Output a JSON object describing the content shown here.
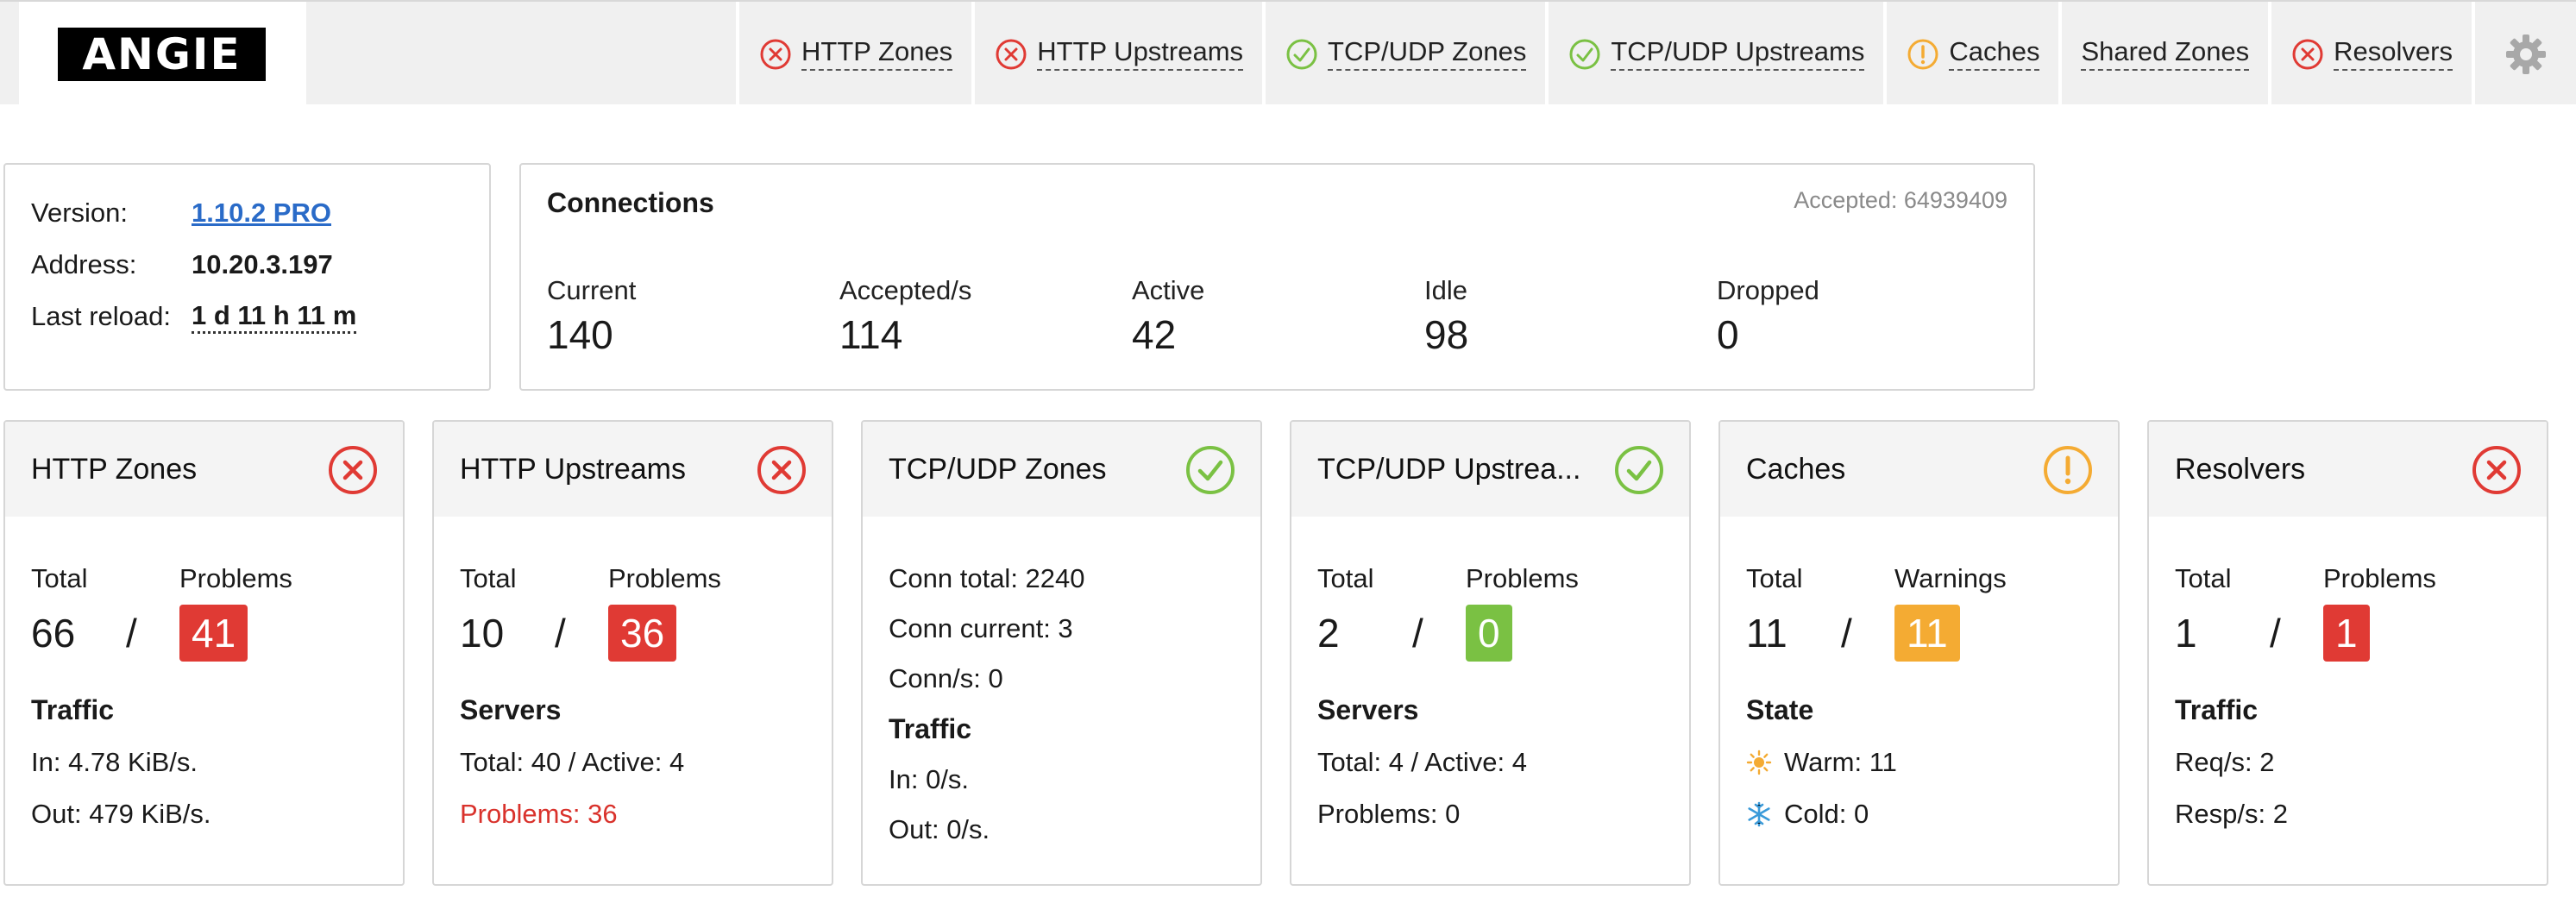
{
  "brand": {
    "logo_text": "ANGIE"
  },
  "nav": {
    "tabs": [
      {
        "label": "HTTP Zones",
        "icon": "error-icon"
      },
      {
        "label": "HTTP Upstreams",
        "icon": "error-icon"
      },
      {
        "label": "TCP/UDP Zones",
        "icon": "ok-icon"
      },
      {
        "label": "TCP/UDP Upstreams",
        "icon": "ok-icon"
      },
      {
        "label": "Caches",
        "icon": "warning-icon"
      },
      {
        "label": "Shared Zones",
        "icon": ""
      },
      {
        "label": "Resolvers",
        "icon": "error-icon"
      }
    ],
    "settings_icon": "gear-icon"
  },
  "info": {
    "version_label": "Version:",
    "version_value": "1.10.2 PRO",
    "address_label": "Address:",
    "address_value": "10.20.3.197",
    "reload_label": "Last reload:",
    "reload_value": "1 d 11 h 11 m"
  },
  "connections": {
    "title": "Connections",
    "accepted": "Accepted: 64939409",
    "metrics": [
      {
        "label": "Current",
        "value": "140"
      },
      {
        "label": "Accepted/s",
        "value": "114"
      },
      {
        "label": "Active",
        "value": "42"
      },
      {
        "label": "Idle",
        "value": "98"
      },
      {
        "label": "Dropped",
        "value": "0"
      }
    ]
  },
  "cards": {
    "http_zones": {
      "title": "HTTP Zones",
      "status": "error",
      "total_label": "Total",
      "problems_label": "Problems",
      "total": "66",
      "separator": "/",
      "problems": "41",
      "section": "Traffic",
      "line1": "In: 4.78 KiB/s.",
      "line2": "Out: 479 KiB/s."
    },
    "http_upstreams": {
      "title": "HTTP Upstreams",
      "status": "error",
      "total_label": "Total",
      "problems_label": "Problems",
      "total": "10",
      "separator": "/",
      "problems": "36",
      "section": "Servers",
      "line1": "Total: 40 / Active: 4",
      "line2": "Problems: 36"
    },
    "tcp_zones": {
      "title": "TCP/UDP Zones",
      "status": "ok",
      "line1": "Conn total: 2240",
      "line2": "Conn current: 3",
      "line3": "Conn/s: 0",
      "section": "Traffic",
      "line4": "In: 0/s.",
      "line5": "Out: 0/s."
    },
    "tcp_upstreams": {
      "title": "TCP/UDP Upstrea...",
      "status": "ok",
      "total_label": "Total",
      "problems_label": "Problems",
      "total": "2",
      "separator": "/",
      "problems": "0",
      "section": "Servers",
      "line1": "Total: 4 / Active: 4",
      "line2": "Problems: 0"
    },
    "caches": {
      "title": "Caches",
      "status": "warning",
      "total_label": "Total",
      "problems_label": "Warnings",
      "total": "11",
      "separator": "/",
      "problems": "11",
      "section": "State",
      "line1": "Warm: 11",
      "line2": "Cold: 0"
    },
    "resolvers": {
      "title": "Resolvers",
      "status": "error",
      "total_label": "Total",
      "problems_label": "Problems",
      "total": "1",
      "separator": "/",
      "problems": "1",
      "section": "Traffic",
      "line1": "Req/s: 2",
      "line2": "Resp/s: 2"
    }
  },
  "colors": {
    "error": "#e03a34",
    "ok": "#7ac143",
    "warning": "#f4ab33",
    "link": "#2a6bc8"
  }
}
